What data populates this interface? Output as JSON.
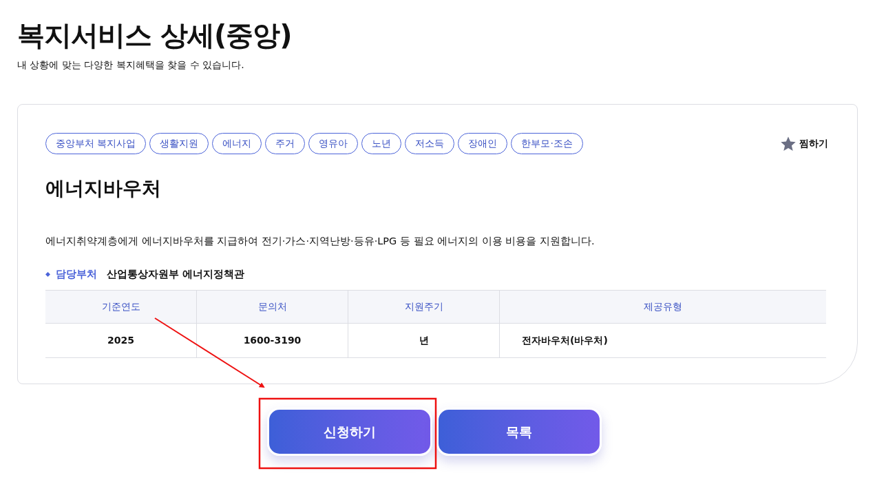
{
  "page": {
    "title": "복지서비스 상세(중앙)",
    "subtitle": "내 상황에 맞는 다양한 복지혜택을 찾을 수 있습니다."
  },
  "tags": [
    "중앙부처 복지사업",
    "생활지원",
    "에너지",
    "주거",
    "영유아",
    "노년",
    "저소득",
    "장애인",
    "한부모·조손"
  ],
  "favorite": {
    "label": "찜하기"
  },
  "service": {
    "name": "에너지바우처",
    "description": "에너지취약계층에게 에너지바우처를 지급하여 전기·가스·지역난방·등유·LPG 등 필요 에너지의 이용 비용을 지원합니다.",
    "department": {
      "label": "담당부처",
      "value": "산업통상자원부 에너지정책관"
    }
  },
  "table": {
    "columns": [
      "기준연도",
      "문의처",
      "지원주기",
      "제공유형"
    ],
    "rows": [
      [
        "2025",
        "1600-3190",
        "년",
        "전자바우처(바우처)"
      ]
    ]
  },
  "buttons": [
    "신청하기",
    "목록"
  ]
}
